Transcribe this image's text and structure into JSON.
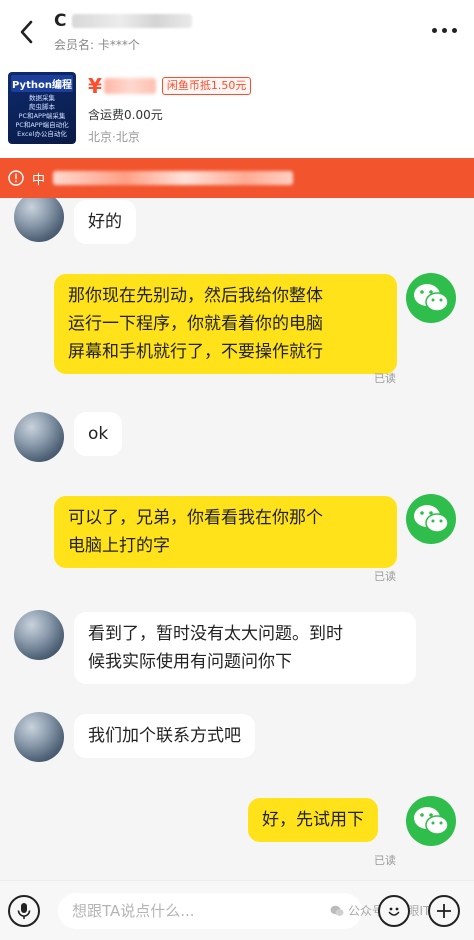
{
  "header": {
    "title": "C",
    "member_label": "会员名: 卡***个"
  },
  "product": {
    "thumb": {
      "title": "Python编程",
      "lines": [
        "数据采集",
        "爬虫脚本",
        "PC和APP端采集",
        "PC和APP端自动化",
        "Excel办公自动化"
      ]
    },
    "currency": "¥",
    "coin_offset": "闲鱼币抵1.50元",
    "shipping": "含运费0.00元",
    "location": "北京·北京"
  },
  "notice": {
    "icon": "alert-circle-icon",
    "text": "中"
  },
  "messages": [
    {
      "side": "left",
      "text": "好的"
    },
    {
      "side": "right",
      "text": "那你现在先别动，然后我给你整体\n运行一下程序，你就看着你的电脑\n屏幕和手机就行了，不要操作就行",
      "read": "已读"
    },
    {
      "side": "left",
      "text": "ok"
    },
    {
      "side": "right",
      "text": "可以了，兄弟，你看看我在你那个\n电脑上打的字",
      "read": "已读"
    },
    {
      "side": "left",
      "text": "看到了，暂时没有太大问题。到时\n候我实际使用有问题问你下"
    },
    {
      "side": "left",
      "text": "我们加个联系方式吧"
    },
    {
      "side": "right",
      "text": "好，先试用下",
      "read": "已读"
    }
  ],
  "input": {
    "placeholder": "想跟TA说点什么..."
  },
  "watermark": "公众号 · 大眼IT",
  "colors": {
    "accent": "#ff4c2c",
    "notice_bg": "#f2542d",
    "my_bubble": "#ffe21a",
    "their_bubble": "#ffffff",
    "wechat_green": "#2fbe4c"
  }
}
